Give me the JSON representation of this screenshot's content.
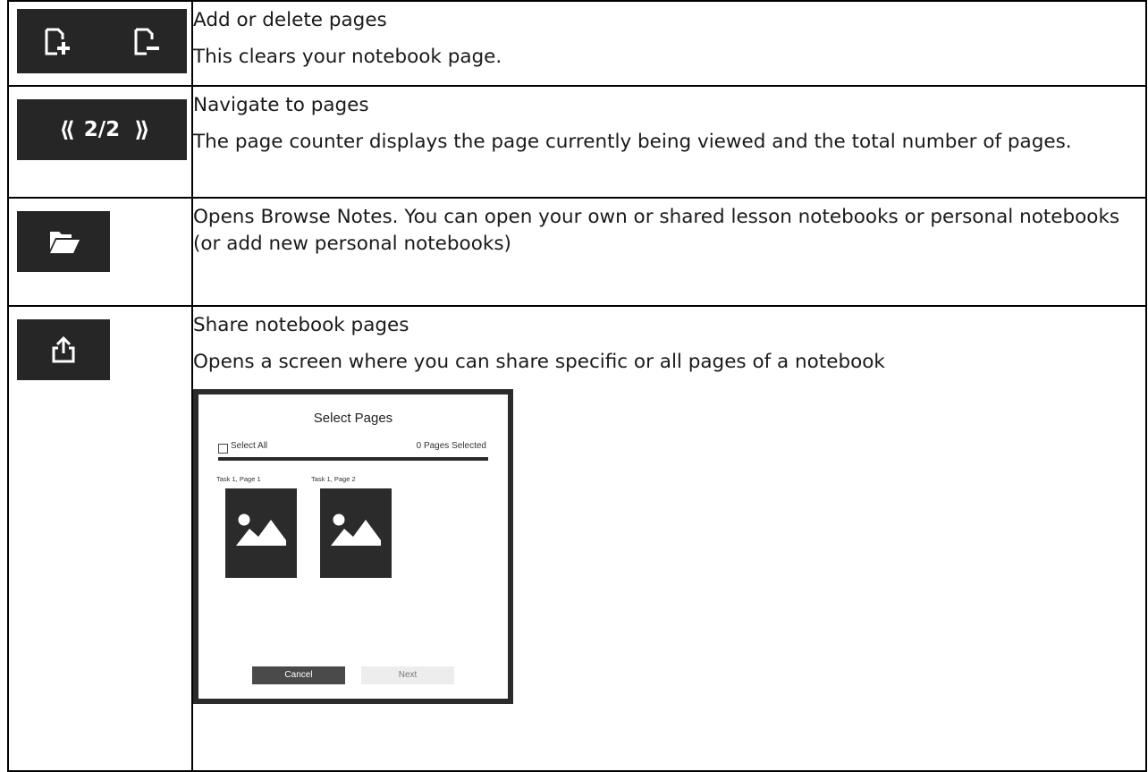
{
  "rows": [
    {
      "icon_names": [
        "add-page-icon",
        "delete-page-icon"
      ],
      "title": "Add or delete pages",
      "body": "This clears your notebook page."
    },
    {
      "pager": {
        "current": "2/2",
        "prev_glyph": "⟪",
        "next_glyph": "⟫"
      },
      "title": "Navigate to pages",
      "body": "The page counter displays the page currently being viewed and the total number of pages."
    },
    {
      "icon_names": [
        "folder-open-icon"
      ],
      "title": "Opens Browse Notes. You can open your own or shared lesson notebooks or personal notebooks (or add new personal notebooks)"
    },
    {
      "icon_names": [
        "share-icon"
      ],
      "title": "Share notebook pages",
      "body": "Opens a screen where you can share specific or all pages of a notebook",
      "dialog": {
        "title": "Select Pages",
        "select_all": "Select All",
        "selected_count": "0 Pages Selected",
        "thumbnails": [
          {
            "label": "Task 1, Page 1",
            "icon": "image-icon"
          },
          {
            "label": "Task 1, Page 2",
            "icon": "image-icon"
          }
        ],
        "cancel": "Cancel",
        "next": "Next"
      }
    }
  ],
  "colors": {
    "icon_bg": "#262626",
    "border": "#000000",
    "cancel_bg": "#4a4a4a",
    "next_bg": "#ededed"
  }
}
